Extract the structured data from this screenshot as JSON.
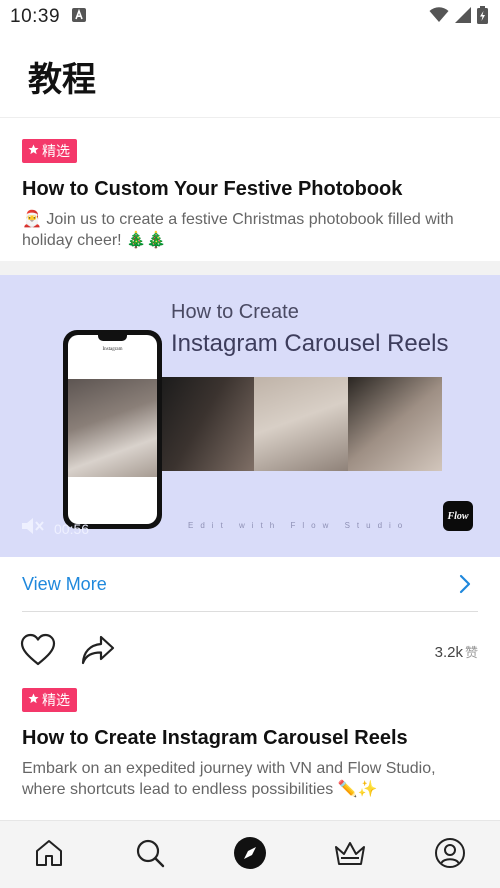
{
  "status_bar": {
    "time": "10:39"
  },
  "header": {
    "title": "教程"
  },
  "featured_card": {
    "badge": "精选",
    "title": "How to Custom Your Festive Photobook",
    "description": "🎅 Join us to create a festive Christmas photobook filled with holiday cheer! 🎄🎄"
  },
  "video": {
    "line1": "How to Create",
    "line2": "Instagram Carousel Reels",
    "footer_text": "Edit with Flow Studio",
    "duration": "00:56",
    "logo_text": "Flow",
    "phone_app_name": "Instagram"
  },
  "view_more": {
    "label": "View More"
  },
  "actions": {
    "likes": "3.2k",
    "likes_unit": "赞"
  },
  "second_card": {
    "badge": "精选",
    "title": "How to Create Instagram Carousel Reels",
    "description": "Embark on an expedited journey with VN and Flow Studio, where shortcuts lead to endless possibilities ✏️✨"
  },
  "tabbar": {
    "items": [
      {
        "icon": "home-icon"
      },
      {
        "icon": "search-icon"
      },
      {
        "icon": "compass-icon",
        "active": true
      },
      {
        "icon": "crown-icon"
      },
      {
        "icon": "profile-icon"
      }
    ]
  },
  "colors": {
    "badge": "#f4386a",
    "link": "#1f88dc",
    "banner": "#d9dcf9"
  }
}
